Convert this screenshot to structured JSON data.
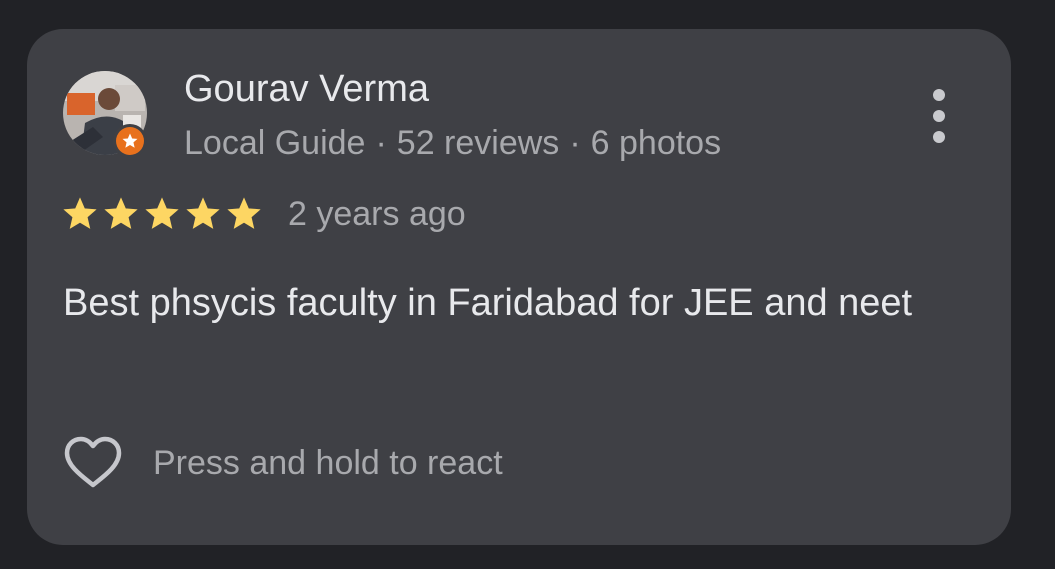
{
  "reviewer": {
    "name": "Gourav Verma",
    "badge": "Local Guide",
    "reviews": "52 reviews",
    "photos": "6 photos",
    "separator": "·",
    "avatar_icon": "user-photo",
    "badge_icon": "local-guide-star-icon"
  },
  "rating": {
    "stars": 5,
    "max_stars": 5,
    "time": "2 years ago",
    "star_color": "#fdd663"
  },
  "review": {
    "text": "Best phsycis faculty in Faridabad for JEE and neet"
  },
  "reaction": {
    "label": "Press and hold to react",
    "icon": "heart-outline-icon"
  },
  "menu": {
    "icon": "more-vertical-icon"
  },
  "colors": {
    "background": "#212226",
    "card": "#3f4045",
    "badge": "#e8711d"
  }
}
